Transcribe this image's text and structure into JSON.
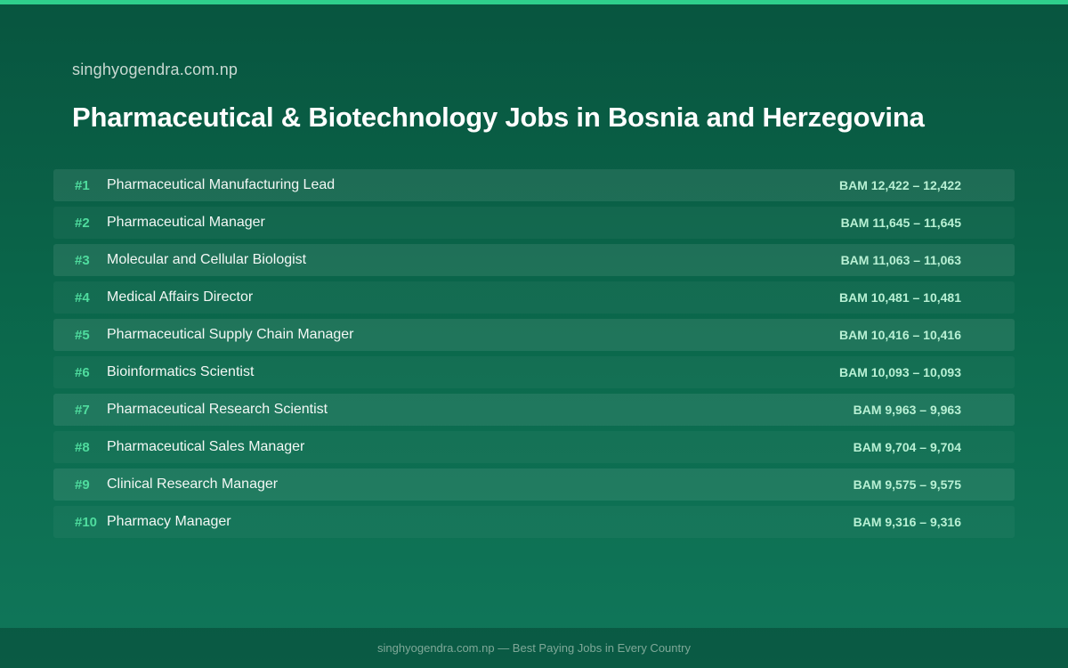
{
  "site_name": "singhyogendra.com.np",
  "title": "Pharmaceutical & Biotechnology Jobs in Bosnia and Herzegovina",
  "jobs": [
    {
      "rank": "#1",
      "title": "Pharmaceutical Manufacturing Lead",
      "salary": "BAM 12,422 – 12,422"
    },
    {
      "rank": "#2",
      "title": "Pharmaceutical Manager",
      "salary": "BAM 11,645 – 11,645"
    },
    {
      "rank": "#3",
      "title": "Molecular and Cellular Biologist",
      "salary": "BAM 11,063 – 11,063"
    },
    {
      "rank": "#4",
      "title": "Medical Affairs Director",
      "salary": "BAM 10,481 – 10,481"
    },
    {
      "rank": "#5",
      "title": "Pharmaceutical Supply Chain Manager",
      "salary": "BAM 10,416 – 10,416"
    },
    {
      "rank": "#6",
      "title": "Bioinformatics Scientist",
      "salary": "BAM 10,093 – 10,093"
    },
    {
      "rank": "#7",
      "title": "Pharmaceutical Research Scientist",
      "salary": "BAM 9,963 – 9,963"
    },
    {
      "rank": "#8",
      "title": "Pharmaceutical Sales Manager",
      "salary": "BAM 9,704 – 9,704"
    },
    {
      "rank": "#9",
      "title": "Clinical Research Manager",
      "salary": "BAM 9,575 – 9,575"
    },
    {
      "rank": "#10",
      "title": "Pharmacy Manager",
      "salary": "BAM 9,316 – 9,316"
    }
  ],
  "footer": "singhyogendra.com.np — Best Paying Jobs in Every Country",
  "colors": {
    "accent": "#2fcf8c",
    "rank": "#4fdc9e",
    "salary": "#b8f0d4",
    "background": "#0b6a4d"
  }
}
